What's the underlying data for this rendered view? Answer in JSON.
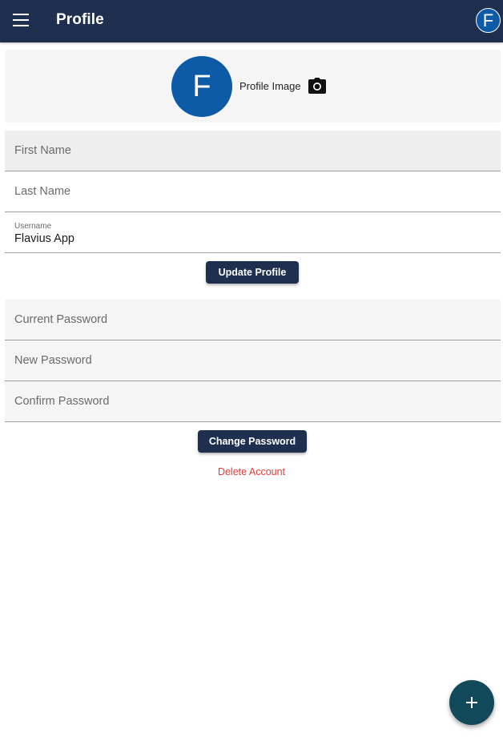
{
  "app_bar": {
    "title": "Profile",
    "menu_icon": "menu-icon",
    "avatar_letter": "F"
  },
  "profile_card": {
    "avatar_letter": "F",
    "image_label": "Profile Image",
    "camera_icon": "camera-icon"
  },
  "profile_form": {
    "first_name": {
      "placeholder": "First Name",
      "value": ""
    },
    "last_name": {
      "placeholder": "Last Name",
      "value": ""
    },
    "username": {
      "label": "Username",
      "value": "Flavius App"
    },
    "update_button": "Update Profile"
  },
  "password_form": {
    "current_password": {
      "placeholder": "Current Password"
    },
    "new_password": {
      "placeholder": "New Password"
    },
    "confirm_password": {
      "placeholder": "Confirm Password"
    },
    "change_button": "Change Password"
  },
  "delete_account": "Delete Account",
  "fab_icon": "plus-icon",
  "colors": {
    "app_bar": "#1e2f4f",
    "avatar": "#0d5aa7",
    "button": "#1e2f4f",
    "danger": "#e53935",
    "fab": "#124a5c"
  }
}
